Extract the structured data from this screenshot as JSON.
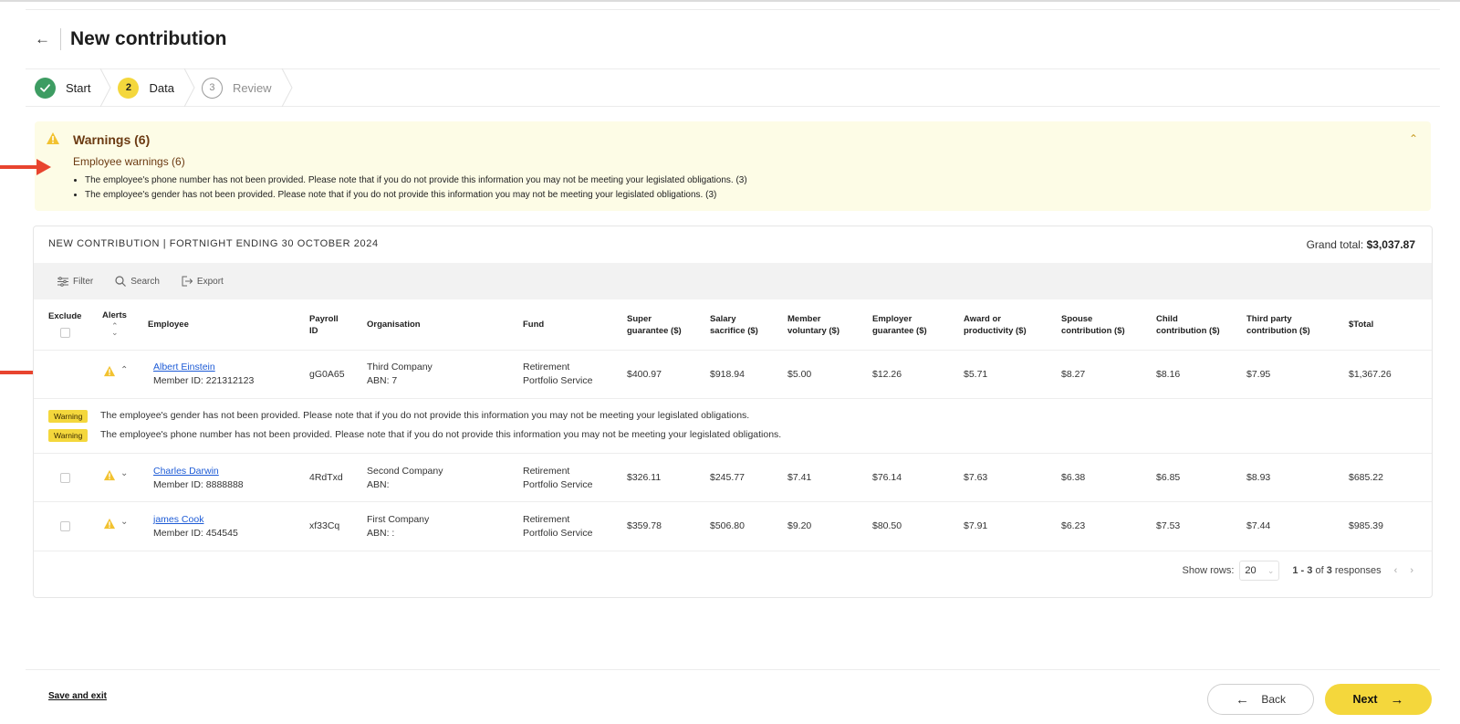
{
  "header": {
    "title": "New contribution",
    "back_icon": "arrow-left-icon"
  },
  "steps": [
    {
      "label": "Start",
      "number": "",
      "state": "done"
    },
    {
      "label": "Data",
      "number": "2",
      "state": "current"
    },
    {
      "label": "Review",
      "number": "3",
      "state": "future"
    }
  ],
  "warnings": {
    "title": "Warnings (6)",
    "employee_title": "Employee warnings (6)",
    "items": [
      "The employee's phone number has not been provided. Please note that if you do not provide this information you may not be meeting your legislated obligations. (3)",
      "The employee's gender has not been provided. Please note that if you do not provide this information you may not be meeting your legislated obligations. (3)"
    ]
  },
  "panel": {
    "heading": "NEW CONTRIBUTION | FORTNIGHT ENDING 30 OCTOBER 2024",
    "grand_total_label": "Grand total:",
    "grand_total_value": "$3,037.87"
  },
  "toolbar": {
    "filter": "Filter",
    "search": "Search",
    "export": "Export"
  },
  "columns": {
    "exclude": "Exclude",
    "alerts": "Alerts",
    "employee": "Employee",
    "payroll_1": "Payroll",
    "payroll_2": "ID",
    "organisation": "Organisation",
    "fund": "Fund",
    "super_1": "Super",
    "super_2": "guarantee ($)",
    "salary_1": "Salary",
    "salary_2": "sacrifice ($)",
    "member_1": "Member",
    "member_2": "voluntary ($)",
    "employer_1": "Employer",
    "employer_2": "guarantee ($)",
    "award_1": "Award or",
    "award_2": "productivity ($)",
    "spouse_1": "Spouse",
    "spouse_2": "contribution ($)",
    "child_1": "Child",
    "child_2": "contribution ($)",
    "third_1": "Third party",
    "third_2": "contribution ($)",
    "total": "$Total"
  },
  "rows": [
    {
      "name": "Albert Einstein",
      "member": "Member ID: 221312123",
      "payroll": "gG0A65",
      "org": "Third Company",
      "abn": "ABN: 7",
      "fund_1": "Retirement",
      "fund_2": "Portfolio Service",
      "super": "$400.97",
      "salary": "$918.94",
      "member_vol": "$5.00",
      "employer": "$12.26",
      "award": "$5.71",
      "spouse": "$8.27",
      "child": "$8.16",
      "third": "$7.95",
      "total": "$1,367.26"
    },
    {
      "name": "Charles Darwin",
      "member": "Member ID: 8888888",
      "payroll": "4RdTxd",
      "org": "Second Company",
      "abn": "ABN:",
      "fund_1": "Retirement",
      "fund_2": "Portfolio Service",
      "super": "$326.11",
      "salary": "$245.77",
      "member_vol": "$7.41",
      "employer": "$76.14",
      "award": "$7.63",
      "spouse": "$6.38",
      "child": "$6.85",
      "third": "$8.93",
      "total": "$685.22"
    },
    {
      "name": "james Cook",
      "member": "Member ID: 454545",
      "payroll": "xf33Cq",
      "org": "First Company",
      "abn": "ABN: :",
      "fund_1": "Retirement",
      "fund_2": "Portfolio Service",
      "super": "$359.78",
      "salary": "$506.80",
      "member_vol": "$9.20",
      "employer": "$80.50",
      "award": "$7.91",
      "spouse": "$6.23",
      "child": "$7.53",
      "third": "$7.44",
      "total": "$985.39"
    }
  ],
  "expanded": [
    {
      "badge": "Warning",
      "text": "The employee's gender has not been provided. Please note that if you do not provide this information you may not be meeting your legislated obligations."
    },
    {
      "badge": "Warning",
      "text": "The employee's phone number has not been provided. Please note that if you do not provide this information you may not be meeting your legislated obligations."
    }
  ],
  "pager": {
    "show_rows": "Show rows:",
    "rows_value": "20",
    "range": "1 - 3",
    "of": "of",
    "count": "3",
    "suffix": "responses"
  },
  "footer": {
    "save_exit": "Save and exit",
    "back": "Back",
    "next": "Next"
  },
  "colors": {
    "accent_yellow": "#f4d73c",
    "done_green": "#3d9c62",
    "warning_bg": "#fdfce6",
    "annotation_red": "#e8442f",
    "link_blue": "#1d5bd6"
  }
}
